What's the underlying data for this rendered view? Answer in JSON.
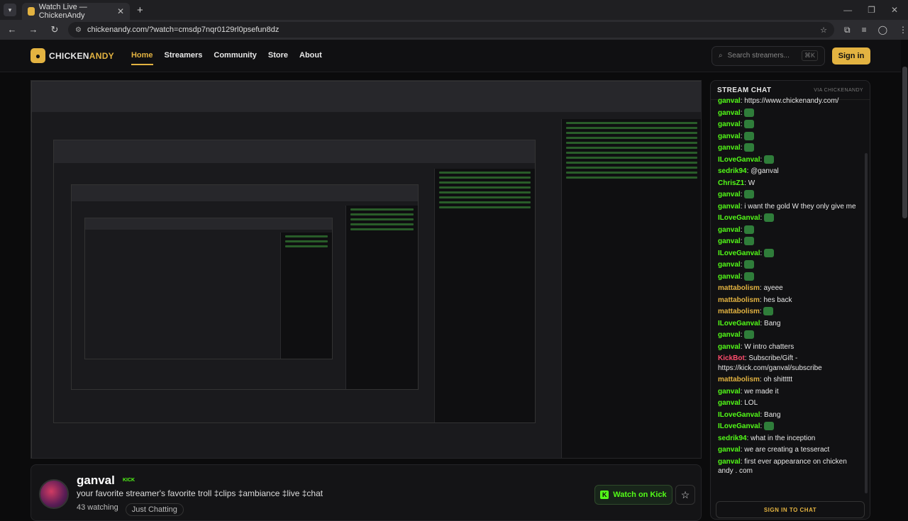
{
  "browser": {
    "tab_title": "Watch Live — ChickenAndy",
    "url": "chickenandy.com/?watch=cmsdp7nqr0129rl0psefun8dz"
  },
  "site": {
    "logo_a": "CHICKEN",
    "logo_b": "ANDY",
    "nav": [
      "Home",
      "Streamers",
      "Community",
      "Store",
      "About"
    ],
    "search_placeholder": "Search streamers...",
    "search_kbd": "⌘K",
    "signin": "Sign in",
    "accent": "#e3b341"
  },
  "player": {
    "viewer_badge": "43"
  },
  "stream": {
    "name": "ganval",
    "platform": "KICK",
    "description": "your favorite streamer's favorite troll ‡clips ‡ambiance ‡live ‡chat",
    "watching": "43 watching",
    "category": "Just Chatting",
    "watch_button": "Watch on Kick"
  },
  "chat": {
    "title": "STREAM CHAT",
    "via": "VIA CHICKENANDY",
    "signin": "SIGN IN TO CHAT",
    "messages": [
      {
        "user": "ganval",
        "color": "#53fc18",
        "text": "https://www.chickenandy.com/"
      },
      {
        "user": "ganval",
        "color": "#53fc18",
        "text": ""
      },
      {
        "user": "ganval",
        "color": "#53fc18",
        "text": ""
      },
      {
        "user": "ganval",
        "color": "#53fc18",
        "text": ""
      },
      {
        "user": "ganval",
        "color": "#53fc18",
        "text": ""
      },
      {
        "user": "ILoveGanval",
        "color": "#53fc18",
        "text": ""
      },
      {
        "user": "sedrik94",
        "color": "#53fc18",
        "text": "@ganval"
      },
      {
        "user": "ChrisZ1",
        "color": "#53fc18",
        "text": "W"
      },
      {
        "user": "ganval",
        "color": "#53fc18",
        "text": ""
      },
      {
        "user": "ganval",
        "color": "#53fc18",
        "text": "i want the gold W they only give me"
      },
      {
        "user": "ILoveGanval",
        "color": "#53fc18",
        "text": ""
      },
      {
        "user": "ganval",
        "color": "#53fc18",
        "text": ""
      },
      {
        "user": "ganval",
        "color": "#53fc18",
        "text": ""
      },
      {
        "user": "ILoveGanval",
        "color": "#53fc18",
        "text": ""
      },
      {
        "user": "ganval",
        "color": "#53fc18",
        "text": ""
      },
      {
        "user": "ganval",
        "color": "#53fc18",
        "text": ""
      },
      {
        "user": "mattabolism",
        "color": "#e3b341",
        "text": "ayeee"
      },
      {
        "user": "mattabolism",
        "color": "#e3b341",
        "text": "hes back"
      },
      {
        "user": "mattabolism",
        "color": "#e3b341",
        "text": ""
      },
      {
        "user": "ILoveGanval",
        "color": "#53fc18",
        "text": "Bang"
      },
      {
        "user": "ganval",
        "color": "#53fc18",
        "text": ""
      },
      {
        "user": "ganval",
        "color": "#53fc18",
        "text": "W intro chatters"
      },
      {
        "user": "KickBot",
        "color": "#ff4d6d",
        "text": "Subscribe/Gift - https://kick.com/ganval/subscribe"
      },
      {
        "user": "mattabolism",
        "color": "#e3b341",
        "text": "oh shittttt"
      },
      {
        "user": "ganval",
        "color": "#53fc18",
        "text": "we made it"
      },
      {
        "user": "ganval",
        "color": "#53fc18",
        "text": "LOL"
      },
      {
        "user": "ILoveGanval",
        "color": "#53fc18",
        "text": "Bang"
      },
      {
        "user": "ILoveGanval",
        "color": "#53fc18",
        "text": ""
      },
      {
        "user": "sedrik94",
        "color": "#53fc18",
        "text": "what in the inception"
      },
      {
        "user": "ganval",
        "color": "#53fc18",
        "text": "we are creating a tesseract"
      },
      {
        "user": "ganval",
        "color": "#53fc18",
        "text": "first ever appearance on chicken andy . com"
      }
    ]
  }
}
